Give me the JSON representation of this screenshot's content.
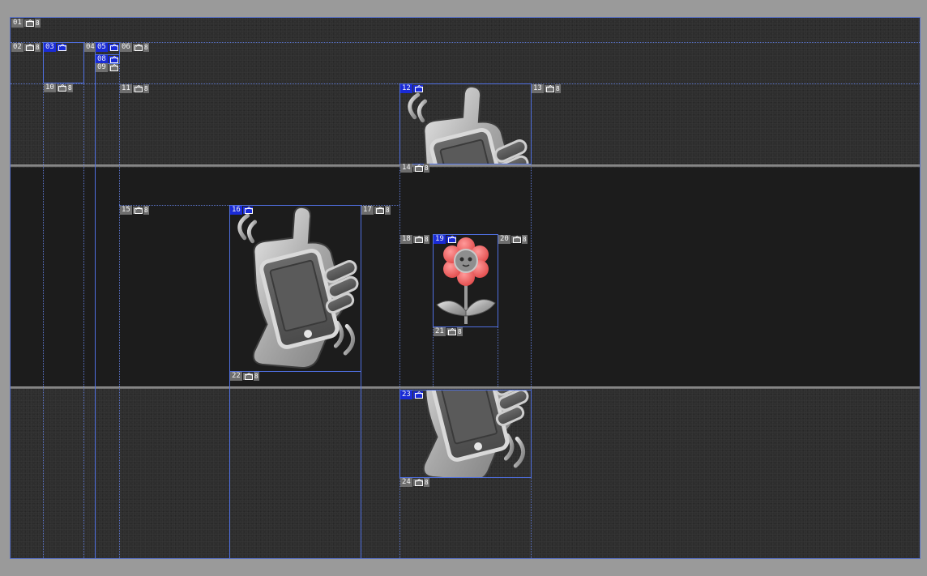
{
  "editor": {
    "mode": "slice-select",
    "accent_color": "#1a2bd6",
    "guide_color": "#5b74c9"
  },
  "slices": [
    {
      "num": "01",
      "ext": "8",
      "selected": false
    },
    {
      "num": "02",
      "ext": "8",
      "selected": false
    },
    {
      "num": "03",
      "ext": "",
      "selected": true
    },
    {
      "num": "04",
      "ext": "",
      "selected": false
    },
    {
      "num": "05",
      "ext": "",
      "selected": true
    },
    {
      "num": "06",
      "ext": "8",
      "selected": false
    },
    {
      "num": "08",
      "ext": "",
      "selected": true
    },
    {
      "num": "09",
      "ext": "",
      "selected": false
    },
    {
      "num": "10",
      "ext": "8",
      "selected": false
    },
    {
      "num": "11",
      "ext": "8",
      "selected": false
    },
    {
      "num": "12",
      "ext": "",
      "selected": true,
      "content_icon": "hand-holding-phone-icon"
    },
    {
      "num": "13",
      "ext": "8",
      "selected": false
    },
    {
      "num": "14",
      "ext": "8",
      "selected": false
    },
    {
      "num": "15",
      "ext": "8",
      "selected": false
    },
    {
      "num": "16",
      "ext": "",
      "selected": true,
      "content_icon": "hand-holding-phone-icon"
    },
    {
      "num": "17",
      "ext": "8",
      "selected": false
    },
    {
      "num": "18",
      "ext": "8",
      "selected": false
    },
    {
      "num": "19",
      "ext": "",
      "selected": true,
      "content_icon": "red-flower-icon"
    },
    {
      "num": "20",
      "ext": "8",
      "selected": false
    },
    {
      "num": "21",
      "ext": "8",
      "selected": false
    },
    {
      "num": "22",
      "ext": "8",
      "selected": false
    },
    {
      "num": "23",
      "ext": "",
      "selected": true,
      "content_icon": "hand-holding-phone-icon"
    },
    {
      "num": "24",
      "ext": "8",
      "selected": false
    }
  ]
}
